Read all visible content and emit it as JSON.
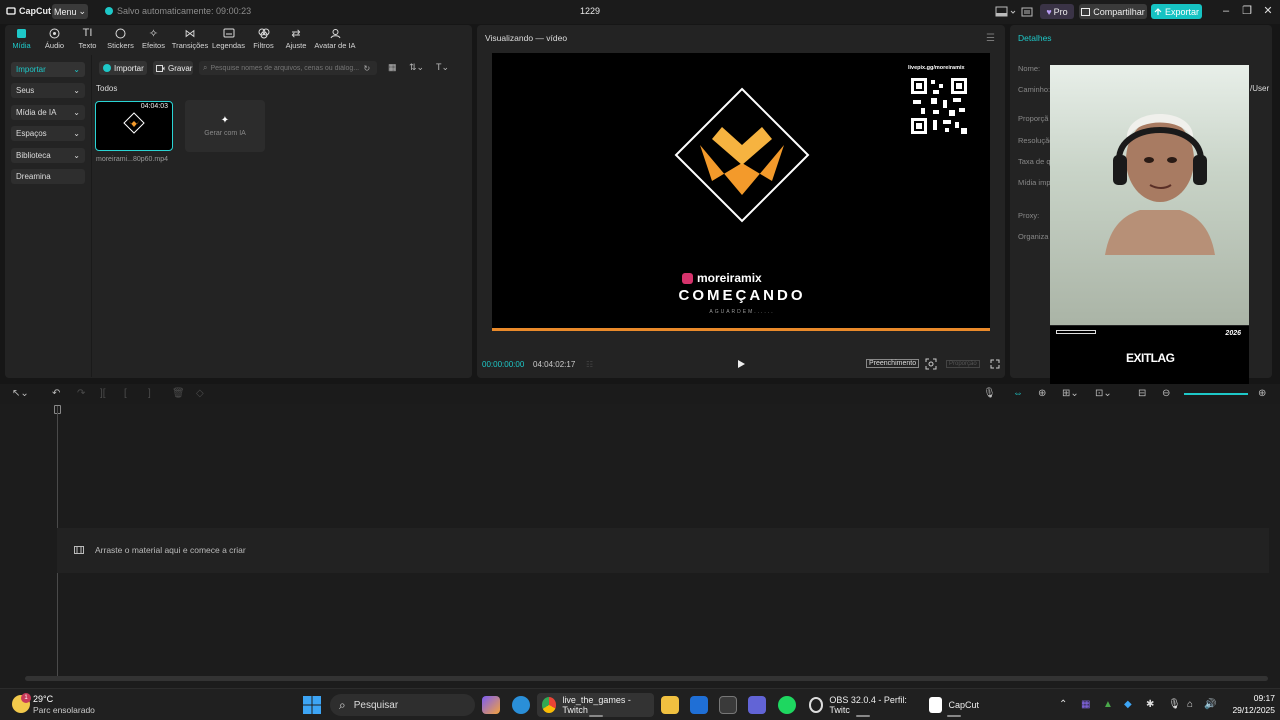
{
  "titlebar": {
    "app_name": "CapCut",
    "menu_label": "Menu",
    "autosave": "Salvo automaticamente: 09:00:23",
    "project_title": "1229",
    "pro_label": "Pro",
    "share_label": "Compartilhar",
    "export_label": "Exportar",
    "accent_color": "#1ec8c8"
  },
  "tool_tabs": [
    {
      "label": "Mídia",
      "icon": "media-icon"
    },
    {
      "label": "Áudio",
      "icon": "audio-icon"
    },
    {
      "label": "Texto",
      "icon": "text-icon"
    },
    {
      "label": "Stickers",
      "icon": "sticker-icon"
    },
    {
      "label": "Efeitos",
      "icon": "effects-icon"
    },
    {
      "label": "Transições",
      "icon": "transition-icon"
    },
    {
      "label": "Legendas",
      "icon": "captions-icon"
    },
    {
      "label": "Filtros",
      "icon": "filter-icon"
    },
    {
      "label": "Ajuste",
      "icon": "adjust-icon"
    },
    {
      "label": "Avatar de IA",
      "icon": "ai-avatar-icon"
    }
  ],
  "side_nav": [
    {
      "label": "Importar"
    },
    {
      "label": "Seus"
    },
    {
      "label": "Mídia de IA"
    },
    {
      "label": "Espaços"
    },
    {
      "label": "Biblioteca"
    },
    {
      "label": "Dreamina"
    }
  ],
  "media": {
    "import_label": "Importar",
    "record_label": "Gravar",
    "search_placeholder": "Pesquise nomes de arquivos, cenas ou diálog...",
    "section_label": "Todos",
    "clip_duration": "04:04:03",
    "clip_name": "moreirami...80p60.mp4",
    "gen_ai_label": "Gerar com IA"
  },
  "player": {
    "title": "Visualizando — vídeo",
    "qr_caption": "livepix.gg/moreiramix",
    "handle": "moreiramix",
    "headline": "COMEÇANDO",
    "subline": "AGUARDEM......",
    "time_current": "00:00:00:00",
    "time_total": "04:04:02:17",
    "fill_label": "Preenchimento",
    "ratio_label": "Proporção"
  },
  "details": {
    "title": "Detalhes",
    "rows": [
      "Nome:",
      "Caminho:",
      "Proporçã",
      "Resolução",
      "Taxa de q",
      "Mídia imp",
      "Proxy:",
      "Organiza"
    ],
    "path_value": "/User"
  },
  "overlay": {
    "exitlag_text": "EXITLAG",
    "exitlag_year": "2026"
  },
  "timeline": {
    "drop_label": "Arraste o material aqui e comece a criar"
  },
  "taskbar": {
    "temperature": "29°C",
    "weather": "Parc ensolarado",
    "weather_badge": "1",
    "search_label": "Pesquisar",
    "chrome_window": "live_the_games - Twitch",
    "obs_window": "OBS 32.0.4 - Perfil: Twitc",
    "capcut_window": "CapCut",
    "time": "09:17",
    "date": "29/12/2025"
  }
}
